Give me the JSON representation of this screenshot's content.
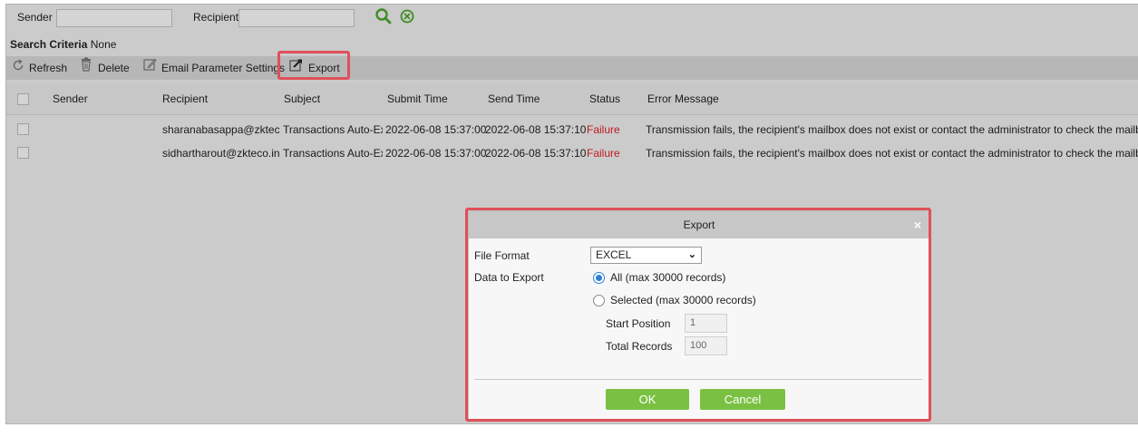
{
  "search": {
    "sender_label": "Sender",
    "recipient_label": "Recipient",
    "sender_value": "",
    "recipient_value": ""
  },
  "criteria": {
    "label": "Search Criteria",
    "value": "None"
  },
  "toolbar": {
    "refresh": "Refresh",
    "delete": "Delete",
    "email_settings": "Email Parameter Settings",
    "export": "Export"
  },
  "table": {
    "headers": [
      "Sender",
      "Recipient",
      "Subject",
      "Submit Time",
      "Send Time",
      "Status",
      "Error Message"
    ],
    "rows": [
      [
        "",
        "sharanabasappa@zkteco",
        "Transactions Auto-Ex|",
        "2022-06-08 15:37:00",
        "2022-06-08 15:37:10",
        "Failure",
        "Transmission fails, the recipient's mailbox does not exist or contact the administrator to check the mailbox para"
      ],
      [
        "",
        "sidhartharout@zkteco.in",
        "Transactions Auto-Ex|",
        "2022-06-08 15:37:00",
        "2022-06-08 15:37:10",
        "Failure",
        "Transmission fails, the recipient's mailbox does not exist or contact the administrator to check the mailbox para"
      ]
    ]
  },
  "dialog": {
    "title": "Export",
    "close": "×",
    "file_format_label": "File Format",
    "file_format_value": "EXCEL",
    "data_label": "Data to Export",
    "option_all": "All (max 30000 records)",
    "option_selected": "Selected (max 30000 records)",
    "start_label": "Start Position",
    "start_value": "1",
    "total_label": "Total Records",
    "total_value": "100",
    "ok": "OK",
    "cancel": "Cancel"
  },
  "colors": {
    "accent": "#7ac143",
    "failure": "#e8202a",
    "highlight": "#e0505a"
  }
}
